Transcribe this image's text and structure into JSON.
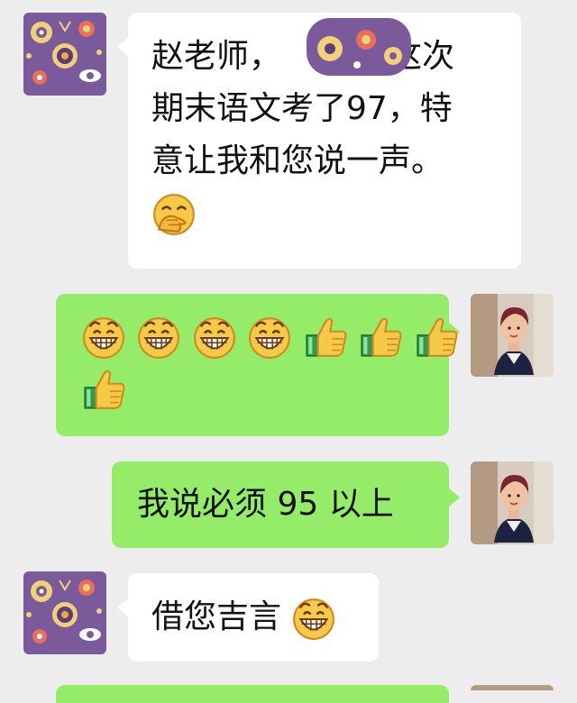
{
  "messages": [
    {
      "sender": "parent",
      "side": "left",
      "lines": [
        "赵老师，",
        "这次",
        "期末语文考了97，特",
        "意让我和您说一声。"
      ],
      "emoji_icon": "hand-over-mouth-emoji"
    },
    {
      "sender": "teacher",
      "side": "right",
      "emojis": [
        "grinning-emoji",
        "grinning-emoji",
        "grinning-emoji",
        "grinning-emoji",
        "thumbs-up-emoji",
        "thumbs-up-emoji",
        "thumbs-up-emoji",
        "thumbs-up-emoji"
      ]
    },
    {
      "sender": "teacher",
      "side": "right",
      "text": "我说必须 95 以上"
    },
    {
      "sender": "parent",
      "side": "left",
      "text": "借您吉言",
      "emoji_icon": "grinning-emoji"
    }
  ],
  "colors": {
    "background": "#ededed",
    "incoming_bubble": "#ffffff",
    "outgoing_bubble": "#95ec69",
    "avatar_purple": "#7b5a9c"
  }
}
